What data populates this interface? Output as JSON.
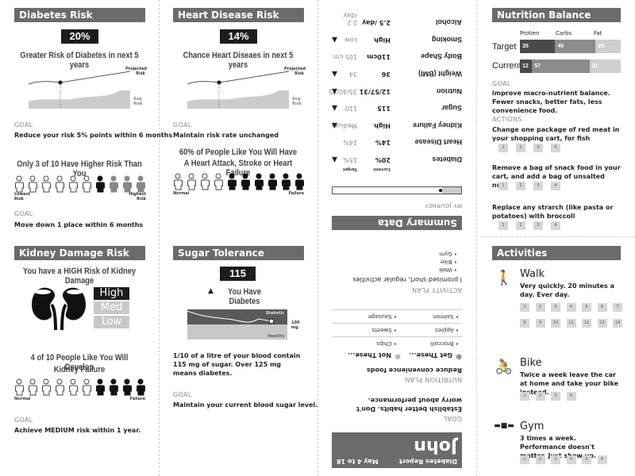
{
  "diabetes": {
    "title": "Diabetes Risk",
    "value": "20%",
    "subtitle": "Greater Risk of Diabetes in next 5 years",
    "projected": "Projected Risk",
    "avg": "Avg Risk",
    "goal_label": "GOAL",
    "goal": "Reduce your risk 5% points within 6 months",
    "people_title": "Only 3 of 10 Have Higher Risk Than You",
    "people": [
      "o",
      "o",
      "o",
      "o",
      "o",
      "o",
      "b",
      "g",
      "g",
      "g"
    ],
    "low_label": "Lowest Risk",
    "high_label": "Highest Risk",
    "goal2_label": "GOAL",
    "goal2": "Move down 1 place within 6 months"
  },
  "heart": {
    "title": "Heart Disease Risk",
    "value": "14%",
    "subtitle": "Chance Heart Diseaes in next 5 years",
    "projected": "Projected Risk",
    "avg": "Avg Risk",
    "goal_label": "GOAL",
    "goal": "Maintain risk rate unchanged",
    "people_title1": "60% of People Like You Will Have",
    "people_title2": "A Heart Attack, Stroke or Heart Failure",
    "people": [
      "o",
      "o",
      "o",
      "o",
      "b",
      "b",
      "b",
      "b",
      "b",
      "b"
    ],
    "low_label": "Normal",
    "high_label": "Failure"
  },
  "kidney": {
    "title": "Kidney Damage Risk",
    "subtitle": "You have a HIGH Risk of Kidney Damage",
    "levels": [
      "High",
      "Med",
      "Low"
    ],
    "active_level": "High",
    "people_title1": "4 of 10 People Like You Will Develop",
    "people_title2": "Kidney Failure",
    "people": [
      "o",
      "o",
      "o",
      "o",
      "o",
      "o",
      "b",
      "b",
      "b",
      "b"
    ],
    "low_label": "Normal",
    "high_label": "Failure",
    "goal_label": "GOAL",
    "goal": "Achieve MEDIUM risk within 1 year."
  },
  "sugar": {
    "title": "Sugar Tolerance",
    "value": "115",
    "warning": "You Have Diabetes",
    "diabetic": "Diabetic",
    "healthy": "Healthy",
    "threshold": "100 mg",
    "desc": "1/10 of a litre of your blood contain 115 mg of sugar. Over 125 mg means diabetes.",
    "goal_label": "GOAL",
    "goal": "Maintain your current blood sugar level."
  },
  "report": {
    "name": "John",
    "title": "Diabetes Report",
    "dates": "May 4 to 18",
    "goal_label": "GOAL",
    "goal": "Establish better habits.  Don't worry about performance.",
    "nutrition_label": "NUTRITION PLAN",
    "nutrition": "Reduce convenience foods",
    "get_label": "Get These...",
    "not_label": "Not These...",
    "get": [
      "Broccolli",
      "Apples",
      "Salmon"
    ],
    "not": [
      "Chips",
      "Sweets",
      "Sausage"
    ],
    "activity_label": "ACTIVITY PLAN",
    "activity": "I promised short, regular activities",
    "activities": [
      "Walk",
      "Bike",
      "Gym"
    ],
    "summary_title": "Summary Data",
    "journey_label": "MY JOURNEY",
    "journey_progress": 0.15,
    "col_current": "Current",
    "col_target": "Target",
    "rows": [
      {
        "label": "Diabetes",
        "current": "20%",
        "target": "15%",
        "arrow": true
      },
      {
        "label": "Heart Disease",
        "current": "14%",
        "target": "14%",
        "arrow": false
      },
      {
        "label": "Kidney Failure",
        "current": "High",
        "target": "Medium",
        "arrow": true
      },
      {
        "label": "Sugar",
        "current": "115",
        "target": "110",
        "arrow": true
      },
      {
        "label": "Nutrion",
        "current": "12/57/31",
        "target": "35/40/25",
        "arrow": true
      },
      {
        "label": "Weight (BMI)",
        "current": "36",
        "target": "34",
        "arrow": true
      },
      {
        "label": "Body Shape",
        "current": "110cm",
        "target": "105 cm",
        "arrow": false
      },
      {
        "label": "Smoking",
        "current": "High",
        "target": "Low",
        "arrow": true
      },
      {
        "label": "Alcohol",
        "current": "2.5 /day",
        "target": "2.2 /day",
        "arrow": false
      }
    ]
  },
  "nutrition": {
    "title": "Nutrition Balance",
    "cols": [
      "Protien",
      "Carbs",
      "Fat"
    ],
    "target_label": "Target",
    "current_label": "Current",
    "target": [
      35,
      40,
      25
    ],
    "current": [
      12,
      57,
      31
    ],
    "colors": [
      "#4a4a4a",
      "#8c8c8c",
      "#cfcfcf"
    ],
    "goal_label": "GOAL",
    "goal": "improve macro-nutrient balance. Fewer snacks, better fats, less convenience food.",
    "actions_label": "ACTIONS",
    "actions": [
      {
        "text": "Change one package of red meat in your shopping cart, for fish",
        "count": 4
      },
      {
        "text": "Remove a bag of snack food in your cart, and add a bag of unsalted nuts",
        "count": 4
      },
      {
        "text": "Replace any strarch (like pasta or potatoes) with broccoli",
        "count": 4
      }
    ]
  },
  "activities": {
    "title": "Activities",
    "items": [
      {
        "name": "Walk",
        "icon": "walk-icon",
        "desc": "Very quickly.  20 minutes a day. Ever day.",
        "count": 14
      },
      {
        "name": "Bike",
        "icon": "bike-icon",
        "desc": "Twice a week leave the car at home and take your bike instead.",
        "count": 4
      },
      {
        "name": "Gym",
        "icon": "dumbbell-icon",
        "desc": "3 times a week.  Performance doesn't matter.  Just show up.",
        "count": 6
      }
    ]
  }
}
